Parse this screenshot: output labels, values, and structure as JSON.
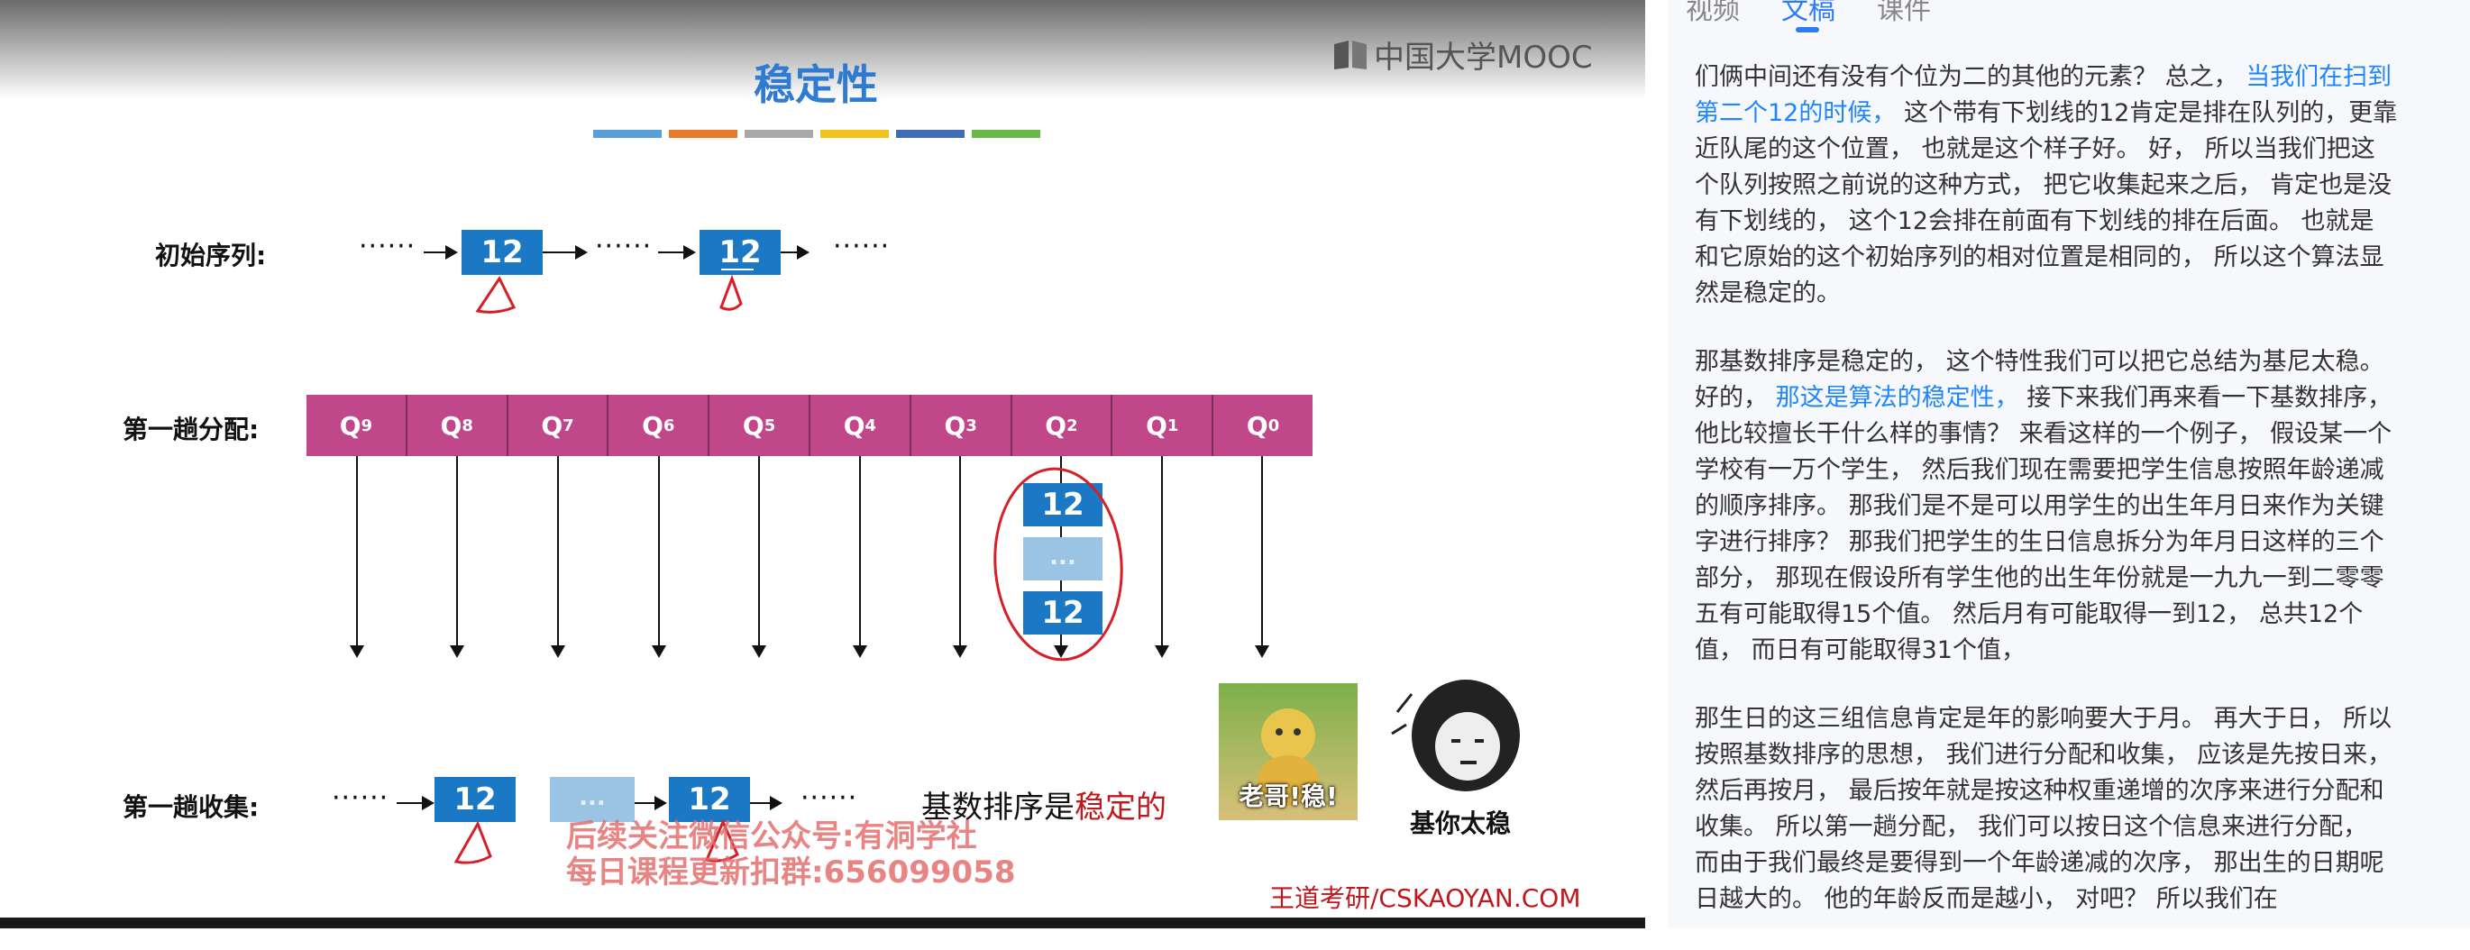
{
  "slide": {
    "logo": "中国大学MOOC",
    "title": "稳定性",
    "colorbar": [
      "#5aa0d8",
      "#e87a2c",
      "#a9a9a9",
      "#f1c21b",
      "#3f6db6",
      "#6ab84a"
    ],
    "initial_label": "初始序列:",
    "first_distribute_label": "第一趟分配:",
    "first_collect_label": "第一趟收集:",
    "dots": "······",
    "node_value": "12",
    "ellipsis": "...",
    "queues": [
      {
        "q": "Q",
        "n": "9"
      },
      {
        "q": "Q",
        "n": "8"
      },
      {
        "q": "Q",
        "n": "7"
      },
      {
        "q": "Q",
        "n": "6"
      },
      {
        "q": "Q",
        "n": "5"
      },
      {
        "q": "Q",
        "n": "4"
      },
      {
        "q": "Q",
        "n": "3"
      },
      {
        "q": "Q",
        "n": "2"
      },
      {
        "q": "Q",
        "n": "1"
      },
      {
        "q": "Q",
        "n": "0"
      }
    ],
    "note_prefix": "基数排序是",
    "note_emphasis": "稳定的",
    "watermark_line1": "后续关注微信公众号:有洞学社",
    "watermark_line2": "每日课程更新扣群:656099058",
    "credit": "王道考研/CSKAOYAN.COM",
    "meme1_caption": "老哥!稳!",
    "meme2_caption": "基你太稳"
  },
  "panel": {
    "tabs": [
      "视频",
      "文稿",
      "课件"
    ],
    "active_tab": 1,
    "p1_a": "们俩中间还有没有个位为二的其他的元素？ 总之，",
    "p1_hl": "当我们在扫到第二个12的时候，",
    "p1_b": "这个带有下划线的12肯定是排在队列的，更靠近队尾的这个位置， 也就是这个样子好。 好， 所以当我们把这个队列按照之前说的这种方式， 把它收集起来之后， 肯定也是没有下划线的， 这个12会排在前面有下划线的排在后面。 也就是和它原始的这个初始序列的相对位置是相同的， 所以这个算法显然是稳定的。",
    "p2_a": "那基数排序是稳定的， 这个特性我们可以把它总结为基尼太稳。 好的，",
    "p2_hl": "那这是算法的稳定性，",
    "p2_b": "接下来我们再来看一下基数排序， 他比较擅长干什么样的事情？ 来看这样的一个例子， 假设某一个学校有一万个学生， 然后我们现在需要把学生信息按照年龄递减的顺序排序。 那我们是不是可以用学生的出生年月日来作为关键字进行排序？ 那我们把学生的生日信息拆分为年月日这样的三个部分， 那现在假设所有学生他的出生年份就是一九九一到二零零五有可能取得15个值。 然后月有可能取得一到12， 总共12个值， 而日有可能取得31个值，",
    "p3": "那生日的这三组信息肯定是年的影响要大于月。 再大于日， 所以按照基数排序的思想， 我们进行分配和收集， 应该是先按日来， 然后再按月， 最后按年就是按这种权重递增的次序来进行分配和收集。 所以第一趟分配， 我们可以按日这个信息来进行分配， 而由于我们最终是要得到一个年龄递减的次序， 那出生的日期呢日越大的。 他的年龄反而是越小， 对吧？ 所以我们在"
  }
}
